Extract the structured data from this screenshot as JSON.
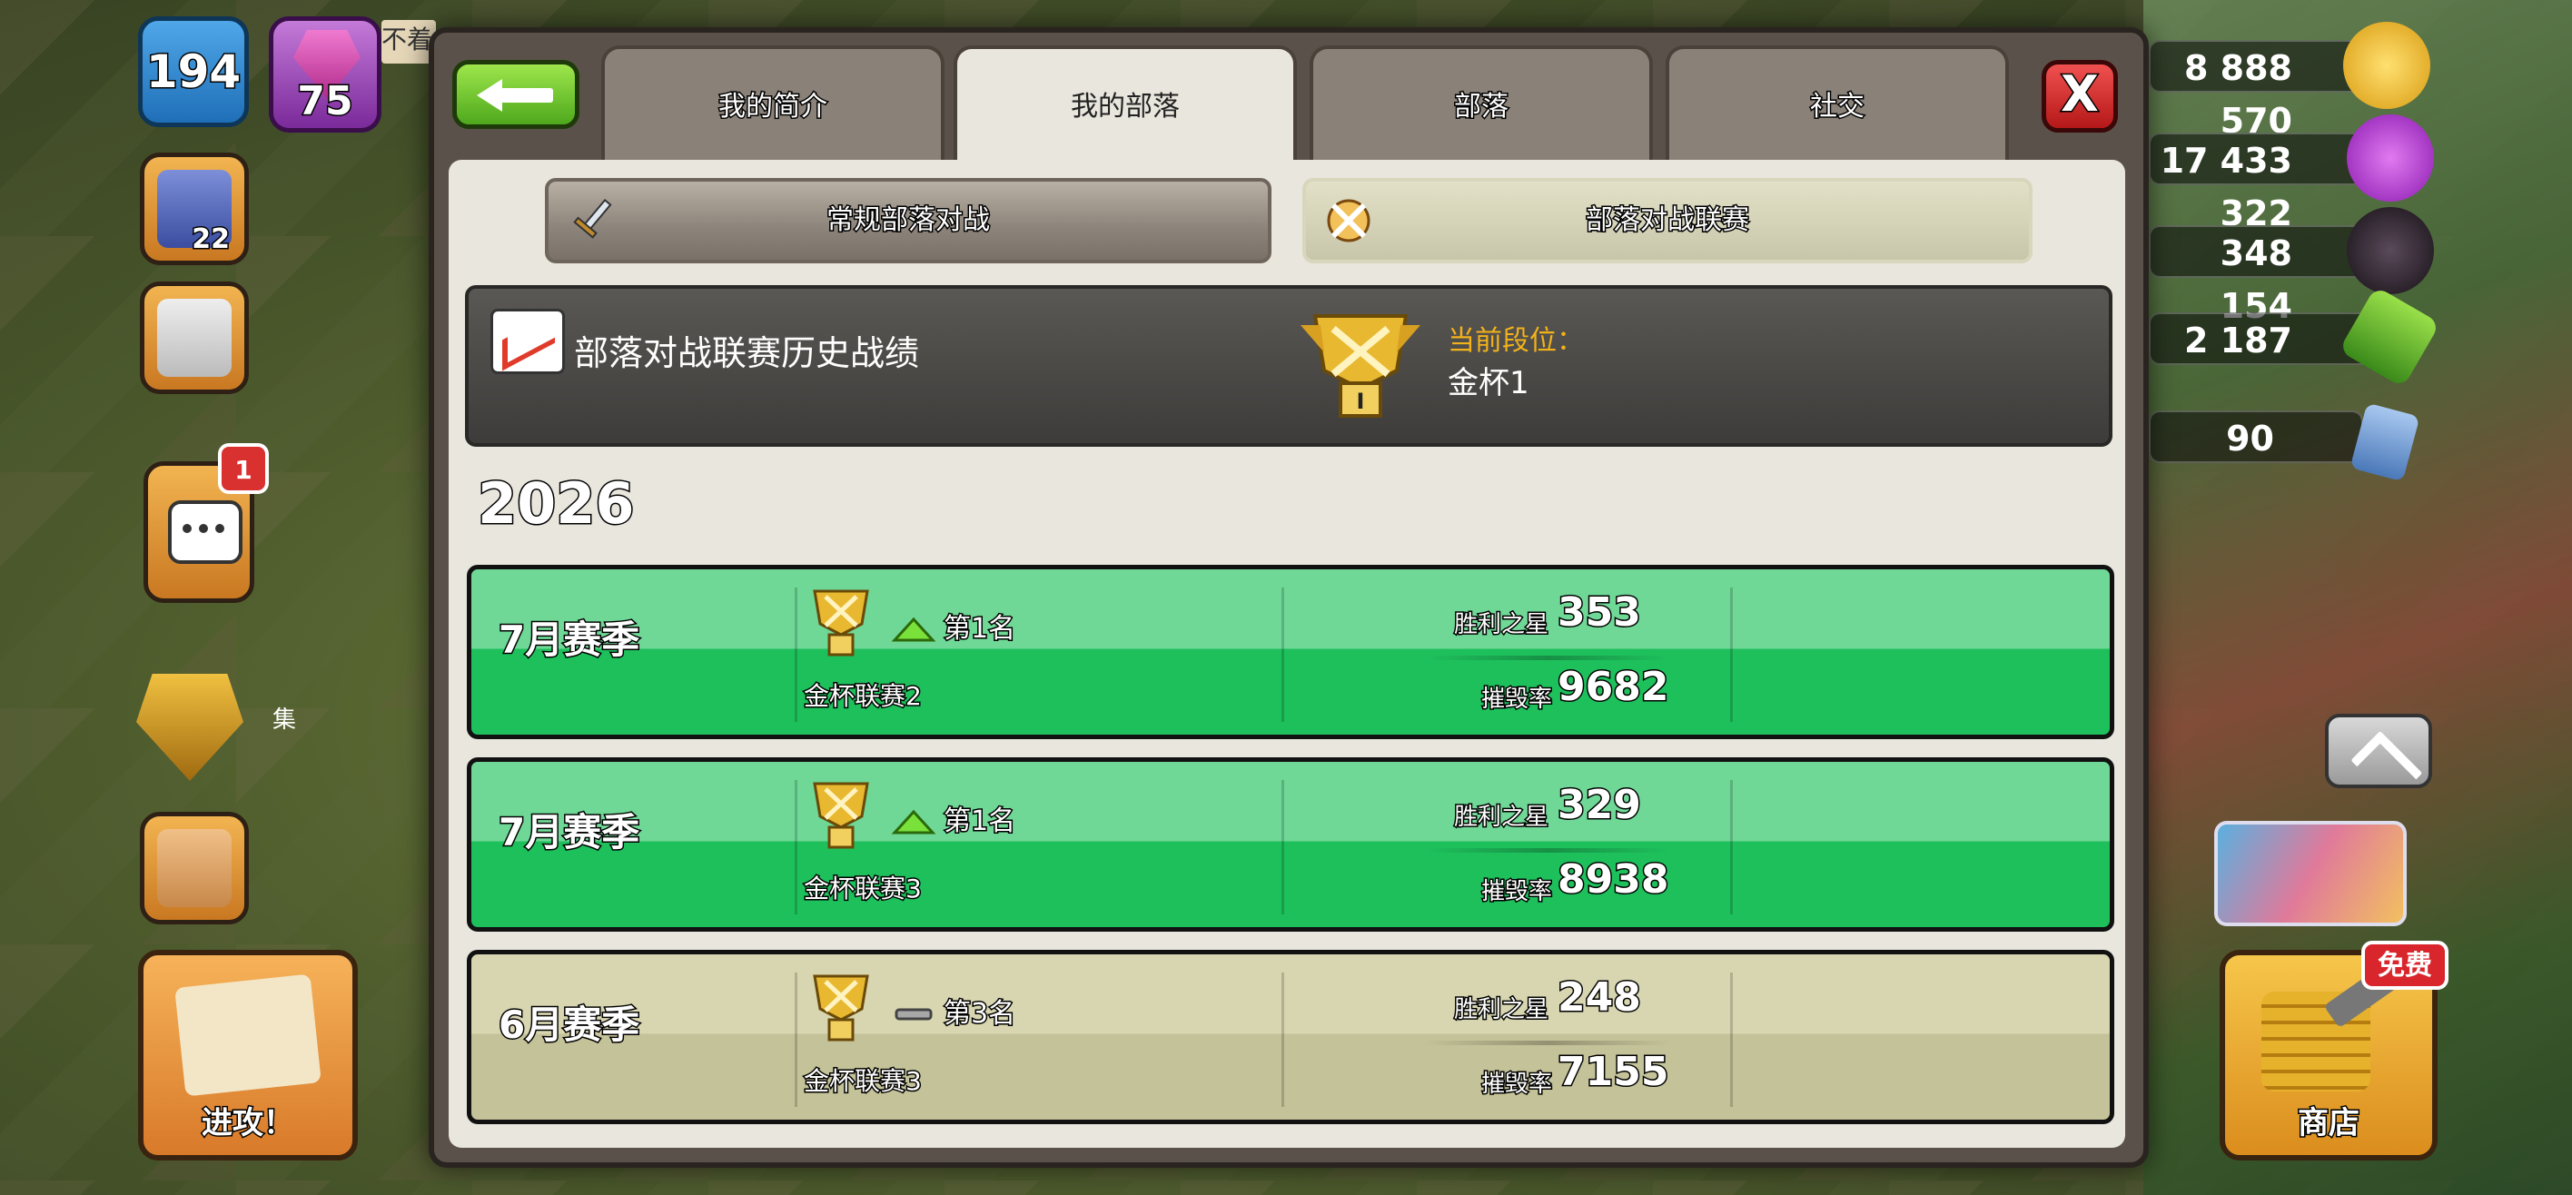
{
  "hud": {
    "xp_level": "194",
    "trophies": "75",
    "player_name": "不着",
    "builder_level": "22",
    "chat_badge": "1",
    "war_label": "集",
    "attack_label": "进攻！",
    "shop_label": "商店",
    "free_badge": "免费",
    "resources": [
      {
        "name": "gold",
        "value": "8 888 570",
        "color": "#f2c21e"
      },
      {
        "name": "elixir",
        "value": "17 433 322",
        "color": "#b43ad8"
      },
      {
        "name": "dark-elixir",
        "value": "348 154",
        "color": "#2a2028"
      },
      {
        "name": "gems",
        "value": "2 187",
        "color": "#5ac02a"
      },
      {
        "name": "raid-medals",
        "value": "90",
        "color": "#6a9ad8"
      }
    ]
  },
  "tabs": [
    {
      "label": "我的简介",
      "active": false
    },
    {
      "label": "我的部落",
      "active": true
    },
    {
      "label": "部落",
      "active": false
    },
    {
      "label": "社交",
      "active": false
    }
  ],
  "close_label": "X",
  "subtabs": {
    "normal": "常规部落对战",
    "league": "部落对战联赛"
  },
  "history": {
    "title": "部落对战联赛历史战绩",
    "rank_label": "当前段位：",
    "rank_value": "金杯1",
    "rank_badge": "I"
  },
  "year": "2026",
  "seasons": [
    {
      "name": "7月赛季",
      "place": "第1名",
      "change": "up",
      "league": "金杯联赛2",
      "stars_label": "胜利之星",
      "stars": "353",
      "destruction_label": "摧毁率",
      "destruction": "9682",
      "style": "green"
    },
    {
      "name": "7月赛季",
      "place": "第1名",
      "change": "up",
      "league": "金杯联赛3",
      "stars_label": "胜利之星",
      "stars": "329",
      "destruction_label": "摧毁率",
      "destruction": "8938",
      "style": "green"
    },
    {
      "name": "6月赛季",
      "place": "第3名",
      "change": "same",
      "league": "金杯联赛3",
      "stars_label": "胜利之星",
      "stars": "248",
      "destruction_label": "摧毁率",
      "destruction": "7155",
      "style": "khaki"
    }
  ]
}
